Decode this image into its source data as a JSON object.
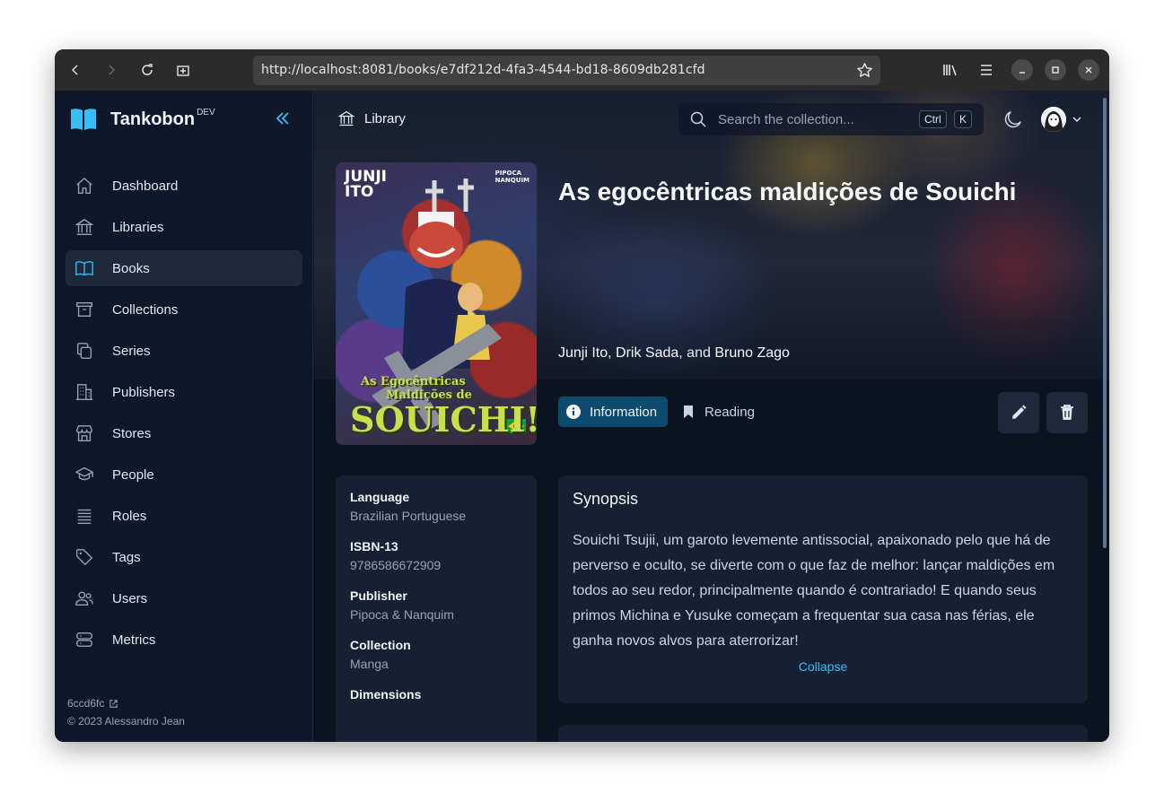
{
  "browser": {
    "url": "http://localhost:8081/books/e7df212d-4fa3-4544-bd18-8609db281cfd",
    "icons": [
      "back-icon",
      "forward-icon",
      "reload-icon",
      "new-tab-icon",
      "bookmark-star-icon",
      "library-icon",
      "menu-icon",
      "minimize-icon",
      "maximize-icon",
      "close-icon"
    ]
  },
  "sidebar": {
    "brand": "Tankobon",
    "brand_badge": "DEV",
    "items": [
      {
        "label": "Dashboard",
        "icon": "home-icon"
      },
      {
        "label": "Libraries",
        "icon": "building-columns-icon"
      },
      {
        "label": "Books",
        "icon": "book-open-icon",
        "active": true
      },
      {
        "label": "Collections",
        "icon": "archive-box-icon"
      },
      {
        "label": "Series",
        "icon": "stack-icon"
      },
      {
        "label": "Publishers",
        "icon": "office-building-icon"
      },
      {
        "label": "Stores",
        "icon": "storefront-icon"
      },
      {
        "label": "People",
        "icon": "academic-cap-icon"
      },
      {
        "label": "Roles",
        "icon": "queue-list-icon"
      },
      {
        "label": "Tags",
        "icon": "tag-icon"
      },
      {
        "label": "Users",
        "icon": "users-icon"
      },
      {
        "label": "Metrics",
        "icon": "server-stack-icon"
      }
    ],
    "commit": "6ccd6fc",
    "copyright": "© 2023 Alessandro Jean"
  },
  "topbar": {
    "breadcrumb": "Library",
    "search_placeholder": "Search the collection...",
    "shortcut_mod": "Ctrl",
    "shortcut_key": "K"
  },
  "book": {
    "title": "As egocêntricas maldições de Souichi",
    "authors": [
      "Junji Ito",
      "Drik Sada",
      "Bruno Zago"
    ],
    "author_sep_1": ", ",
    "author_sep_2": ", and ",
    "cover_text": {
      "author_mark_1": "JUNJI",
      "author_mark_2": "ITO",
      "publisher_mark_1": "PIPOCA",
      "publisher_mark_2": "NANQUIM",
      "art_line_1": "As Egocêntricas",
      "art_line_2": "Maldições de",
      "art_line_3": "SOUICHI!"
    },
    "tabs": [
      {
        "label": "Information",
        "icon": "info-circle-icon",
        "active": true
      },
      {
        "label": "Reading",
        "icon": "bookmark-icon"
      }
    ]
  },
  "info": [
    {
      "label": "Language",
      "value": "Brazilian Portuguese"
    },
    {
      "label": "ISBN-13",
      "value": "9786586672909"
    },
    {
      "label": "Publisher",
      "value": "Pipoca & Nanquim"
    },
    {
      "label": "Collection",
      "value": "Manga"
    },
    {
      "label": "Dimensions",
      "value": ""
    }
  ],
  "synopsis": {
    "title": "Synopsis",
    "body": "Souichi Tsujii, um garoto levemente antissocial, apaixonado pelo que há de perverso e oculto, se diverte com o que faz de melhor: lançar maldições em todos ao seu redor, principalmente quando é contrariado! E quando seus primos Michina e Yusuke começam a frequentar sua casa nas férias, ele ganha novos alvos para aterrorizar!",
    "collapse": "Collapse"
  },
  "colors": {
    "accent": "#38bdf8",
    "active_tab": "#0c4a6e",
    "background": "#0f172a",
    "card": "#172033"
  }
}
